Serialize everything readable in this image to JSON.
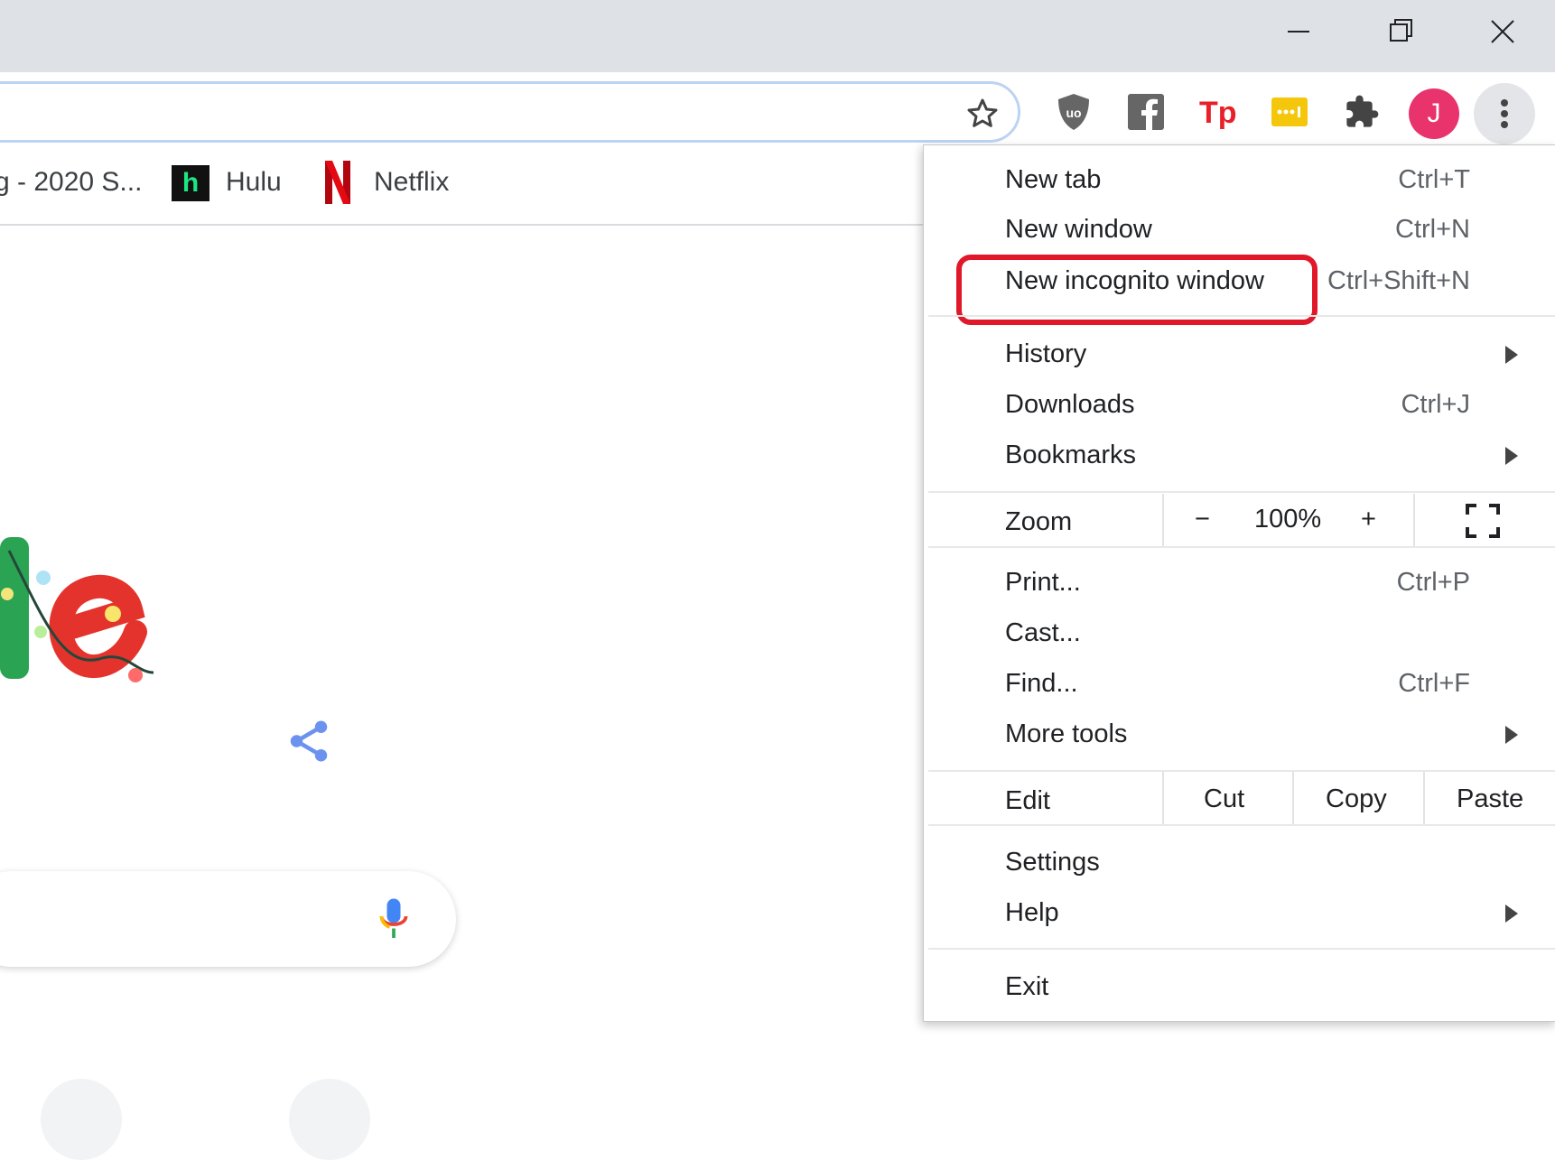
{
  "bookmarks": [
    {
      "label": "g - 2020 S..."
    },
    {
      "label": "Hulu",
      "icon_letter": "h"
    },
    {
      "label": "Netflix",
      "icon_letter": "N"
    }
  ],
  "profile": {
    "initial": "J",
    "color": "#e8336d"
  },
  "menu": {
    "new_tab": {
      "label": "New tab",
      "shortcut": "Ctrl+T"
    },
    "new_window": {
      "label": "New window",
      "shortcut": "Ctrl+N"
    },
    "new_incognito": {
      "label": "New incognito window",
      "shortcut": "Ctrl+Shift+N"
    },
    "history": {
      "label": "History"
    },
    "downloads": {
      "label": "Downloads",
      "shortcut": "Ctrl+J"
    },
    "bookmarks": {
      "label": "Bookmarks"
    },
    "zoom": {
      "label": "Zoom",
      "minus": "−",
      "value": "100%",
      "plus": "+"
    },
    "print": {
      "label": "Print...",
      "shortcut": "Ctrl+P"
    },
    "cast": {
      "label": "Cast..."
    },
    "find": {
      "label": "Find...",
      "shortcut": "Ctrl+F"
    },
    "more_tools": {
      "label": "More tools"
    },
    "edit": {
      "label": "Edit",
      "cut": "Cut",
      "copy": "Copy",
      "paste": "Paste"
    },
    "settings": {
      "label": "Settings"
    },
    "help": {
      "label": "Help"
    },
    "exit": {
      "label": "Exit"
    }
  },
  "colors": {
    "highlight": "#e0182a",
    "titlebar": "#dee1e6",
    "accent": "#4285f4"
  },
  "icons": [
    "minimize-icon",
    "restore-icon",
    "close-icon",
    "star-icon",
    "ublock-icon",
    "facebook-icon",
    "tp-icon",
    "dashlane-icon",
    "puzzle-icon",
    "more-vert-icon",
    "share-icon",
    "mic-icon",
    "fullscreen-icon"
  ]
}
